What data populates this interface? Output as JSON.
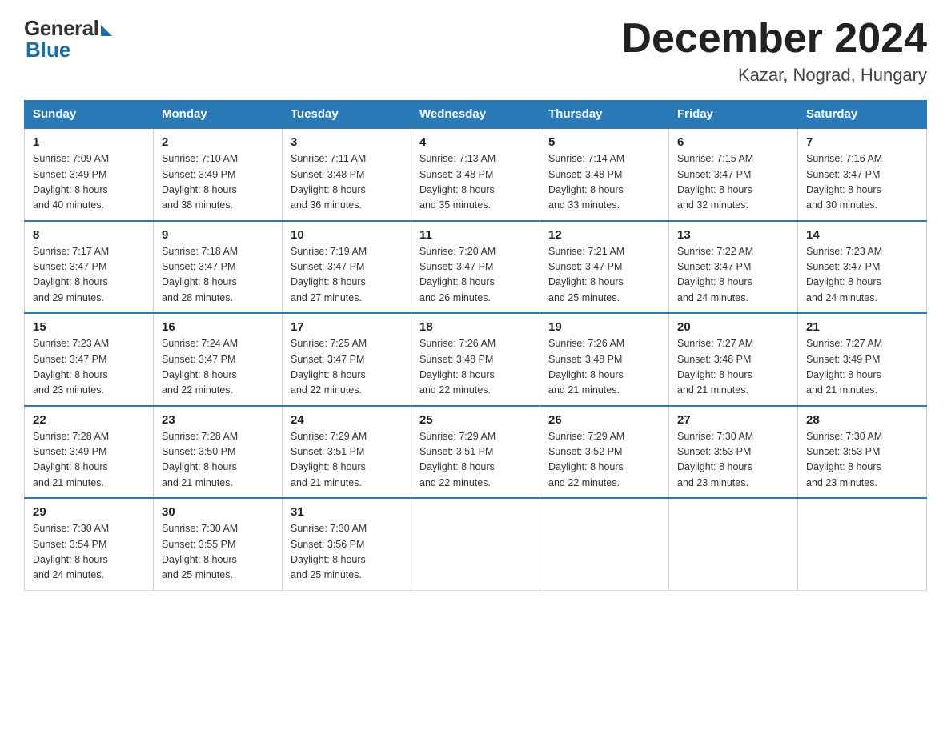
{
  "header": {
    "logo_general": "General",
    "logo_blue": "Blue",
    "month_title": "December 2024",
    "location": "Kazar, Nograd, Hungary"
  },
  "weekdays": [
    "Sunday",
    "Monday",
    "Tuesday",
    "Wednesday",
    "Thursday",
    "Friday",
    "Saturday"
  ],
  "weeks": [
    [
      {
        "day": "1",
        "sunrise": "7:09 AM",
        "sunset": "3:49 PM",
        "daylight": "8 hours and 40 minutes."
      },
      {
        "day": "2",
        "sunrise": "7:10 AM",
        "sunset": "3:49 PM",
        "daylight": "8 hours and 38 minutes."
      },
      {
        "day": "3",
        "sunrise": "7:11 AM",
        "sunset": "3:48 PM",
        "daylight": "8 hours and 36 minutes."
      },
      {
        "day": "4",
        "sunrise": "7:13 AM",
        "sunset": "3:48 PM",
        "daylight": "8 hours and 35 minutes."
      },
      {
        "day": "5",
        "sunrise": "7:14 AM",
        "sunset": "3:48 PM",
        "daylight": "8 hours and 33 minutes."
      },
      {
        "day": "6",
        "sunrise": "7:15 AM",
        "sunset": "3:47 PM",
        "daylight": "8 hours and 32 minutes."
      },
      {
        "day": "7",
        "sunrise": "7:16 AM",
        "sunset": "3:47 PM",
        "daylight": "8 hours and 30 minutes."
      }
    ],
    [
      {
        "day": "8",
        "sunrise": "7:17 AM",
        "sunset": "3:47 PM",
        "daylight": "8 hours and 29 minutes."
      },
      {
        "day": "9",
        "sunrise": "7:18 AM",
        "sunset": "3:47 PM",
        "daylight": "8 hours and 28 minutes."
      },
      {
        "day": "10",
        "sunrise": "7:19 AM",
        "sunset": "3:47 PM",
        "daylight": "8 hours and 27 minutes."
      },
      {
        "day": "11",
        "sunrise": "7:20 AM",
        "sunset": "3:47 PM",
        "daylight": "8 hours and 26 minutes."
      },
      {
        "day": "12",
        "sunrise": "7:21 AM",
        "sunset": "3:47 PM",
        "daylight": "8 hours and 25 minutes."
      },
      {
        "day": "13",
        "sunrise": "7:22 AM",
        "sunset": "3:47 PM",
        "daylight": "8 hours and 24 minutes."
      },
      {
        "day": "14",
        "sunrise": "7:23 AM",
        "sunset": "3:47 PM",
        "daylight": "8 hours and 24 minutes."
      }
    ],
    [
      {
        "day": "15",
        "sunrise": "7:23 AM",
        "sunset": "3:47 PM",
        "daylight": "8 hours and 23 minutes."
      },
      {
        "day": "16",
        "sunrise": "7:24 AM",
        "sunset": "3:47 PM",
        "daylight": "8 hours and 22 minutes."
      },
      {
        "day": "17",
        "sunrise": "7:25 AM",
        "sunset": "3:47 PM",
        "daylight": "8 hours and 22 minutes."
      },
      {
        "day": "18",
        "sunrise": "7:26 AM",
        "sunset": "3:48 PM",
        "daylight": "8 hours and 22 minutes."
      },
      {
        "day": "19",
        "sunrise": "7:26 AM",
        "sunset": "3:48 PM",
        "daylight": "8 hours and 21 minutes."
      },
      {
        "day": "20",
        "sunrise": "7:27 AM",
        "sunset": "3:48 PM",
        "daylight": "8 hours and 21 minutes."
      },
      {
        "day": "21",
        "sunrise": "7:27 AM",
        "sunset": "3:49 PM",
        "daylight": "8 hours and 21 minutes."
      }
    ],
    [
      {
        "day": "22",
        "sunrise": "7:28 AM",
        "sunset": "3:49 PM",
        "daylight": "8 hours and 21 minutes."
      },
      {
        "day": "23",
        "sunrise": "7:28 AM",
        "sunset": "3:50 PM",
        "daylight": "8 hours and 21 minutes."
      },
      {
        "day": "24",
        "sunrise": "7:29 AM",
        "sunset": "3:51 PM",
        "daylight": "8 hours and 21 minutes."
      },
      {
        "day": "25",
        "sunrise": "7:29 AM",
        "sunset": "3:51 PM",
        "daylight": "8 hours and 22 minutes."
      },
      {
        "day": "26",
        "sunrise": "7:29 AM",
        "sunset": "3:52 PM",
        "daylight": "8 hours and 22 minutes."
      },
      {
        "day": "27",
        "sunrise": "7:30 AM",
        "sunset": "3:53 PM",
        "daylight": "8 hours and 23 minutes."
      },
      {
        "day": "28",
        "sunrise": "7:30 AM",
        "sunset": "3:53 PM",
        "daylight": "8 hours and 23 minutes."
      }
    ],
    [
      {
        "day": "29",
        "sunrise": "7:30 AM",
        "sunset": "3:54 PM",
        "daylight": "8 hours and 24 minutes."
      },
      {
        "day": "30",
        "sunrise": "7:30 AM",
        "sunset": "3:55 PM",
        "daylight": "8 hours and 25 minutes."
      },
      {
        "day": "31",
        "sunrise": "7:30 AM",
        "sunset": "3:56 PM",
        "daylight": "8 hours and 25 minutes."
      },
      null,
      null,
      null,
      null
    ]
  ],
  "labels": {
    "sunrise": "Sunrise:",
    "sunset": "Sunset:",
    "daylight": "Daylight:"
  }
}
